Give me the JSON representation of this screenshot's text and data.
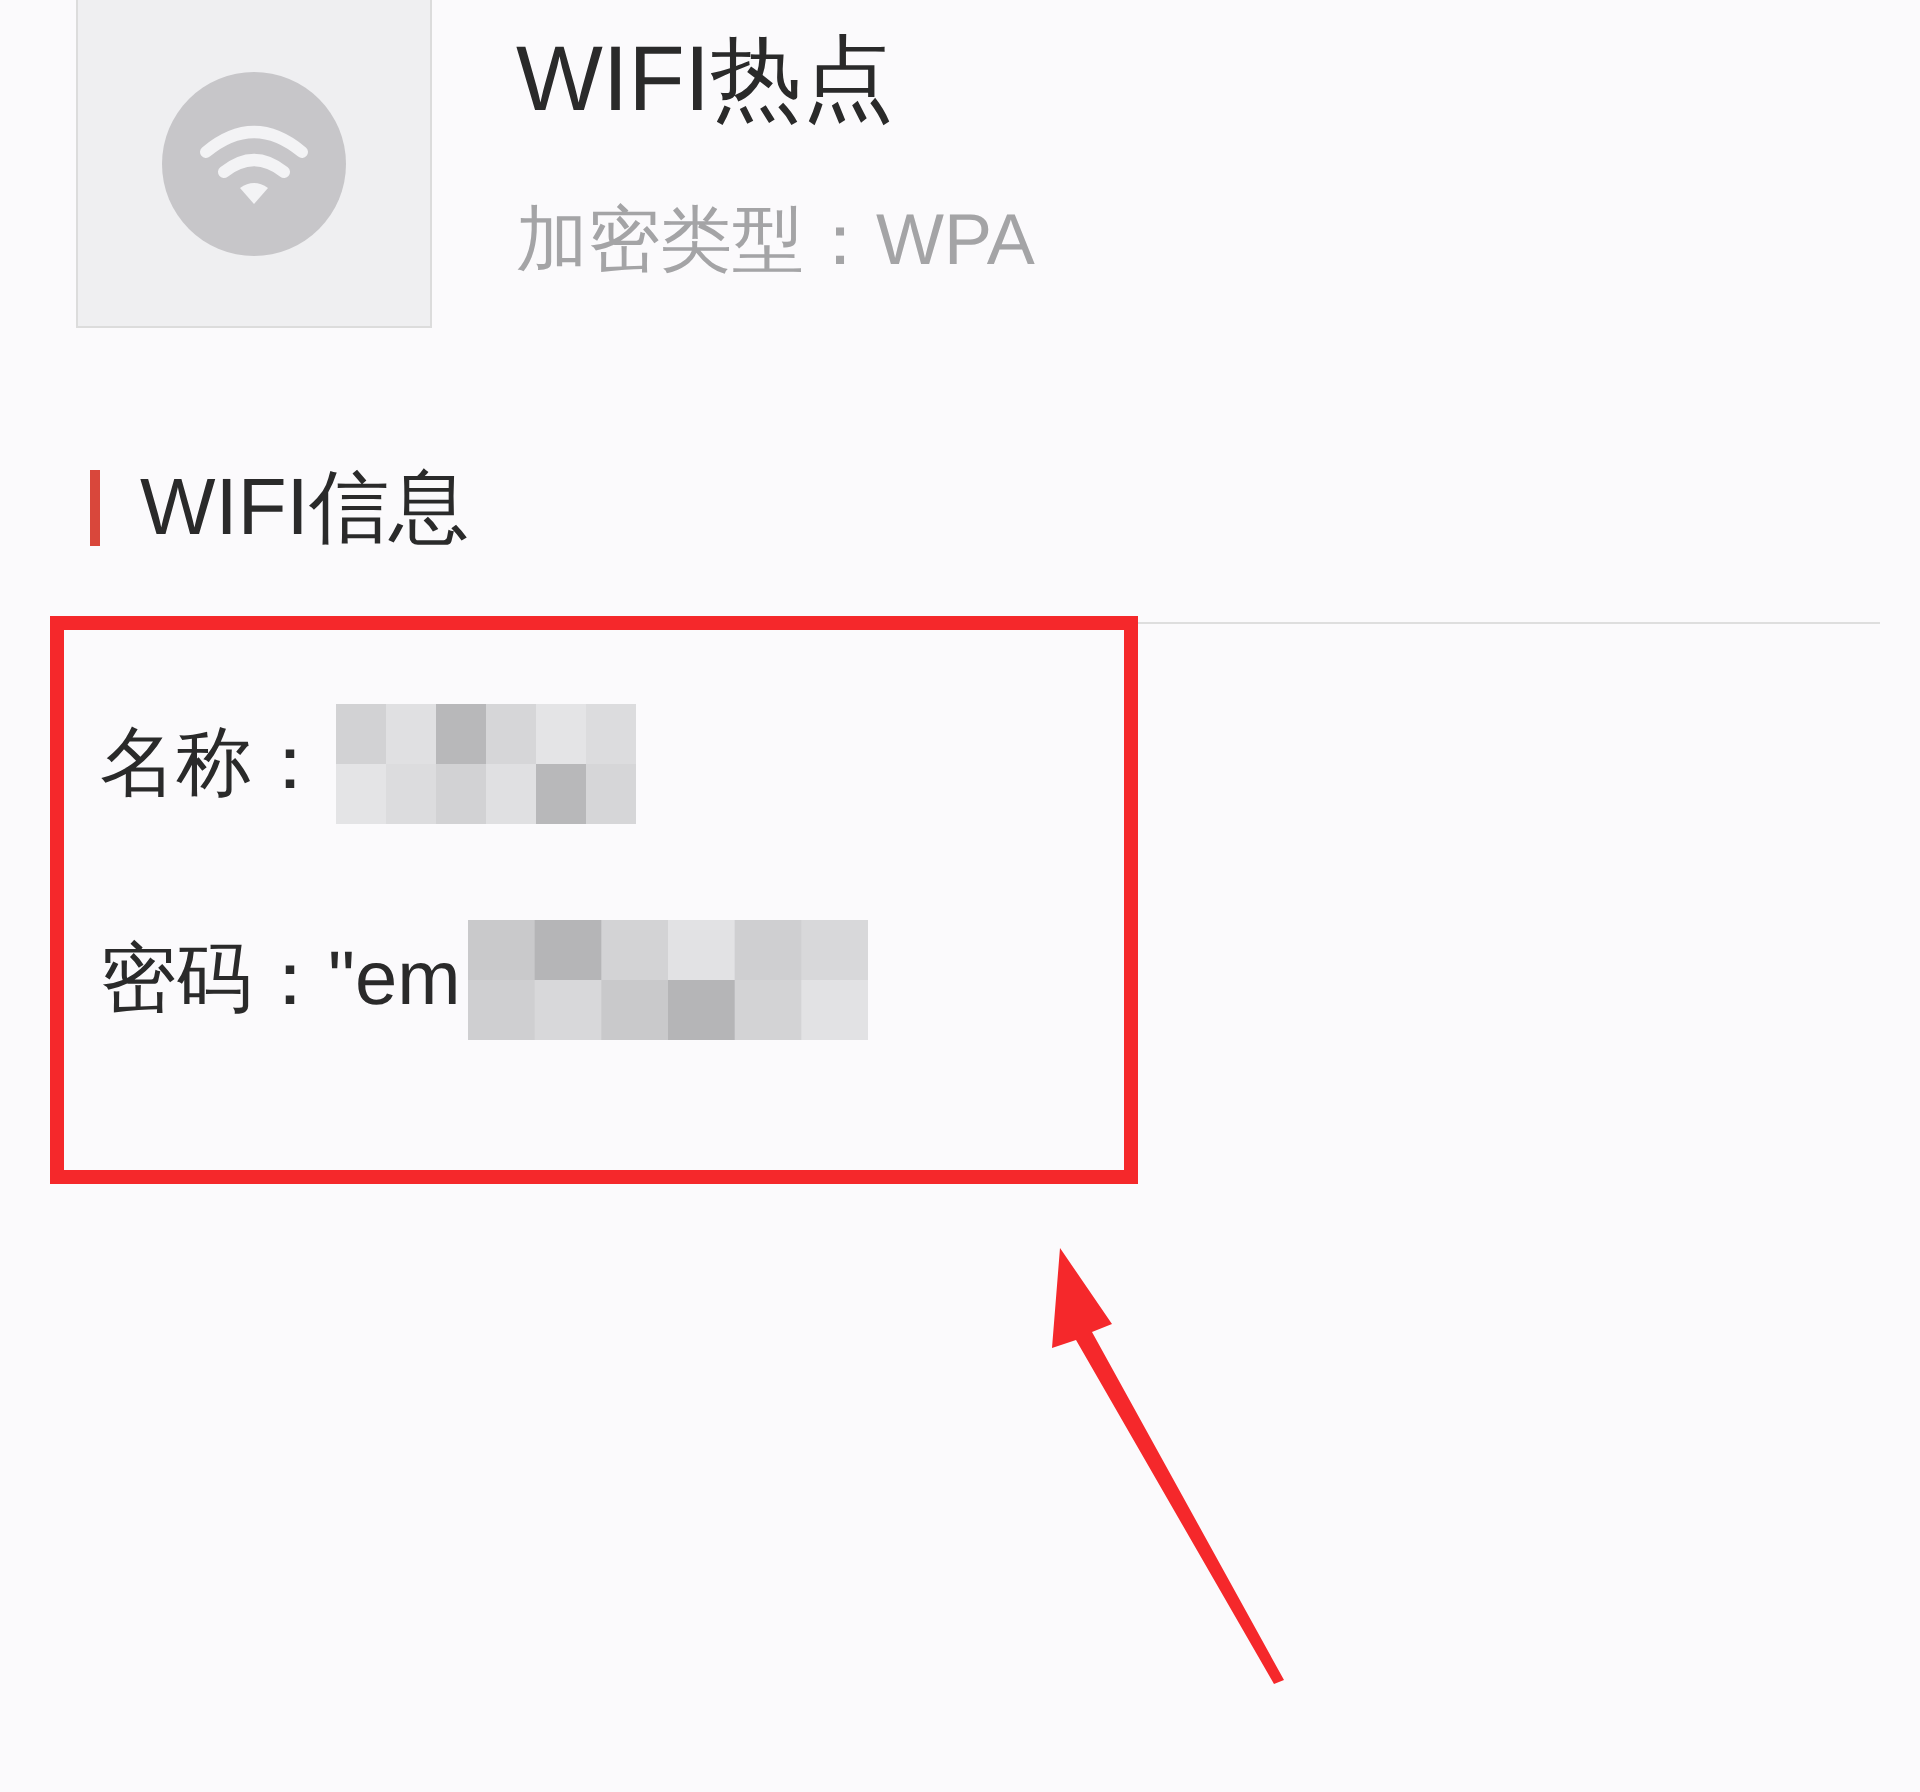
{
  "hotspot": {
    "title": "WIFI热点",
    "encryption": "加密类型：WPA"
  },
  "section": {
    "title": "WIFI信息",
    "fields": [
      {
        "label": "名称：",
        "redacted": true
      },
      {
        "label": "密码：",
        "value": "\"em",
        "redacted": true
      }
    ]
  },
  "annotations": {
    "highlight_box": true,
    "arrow": true
  }
}
